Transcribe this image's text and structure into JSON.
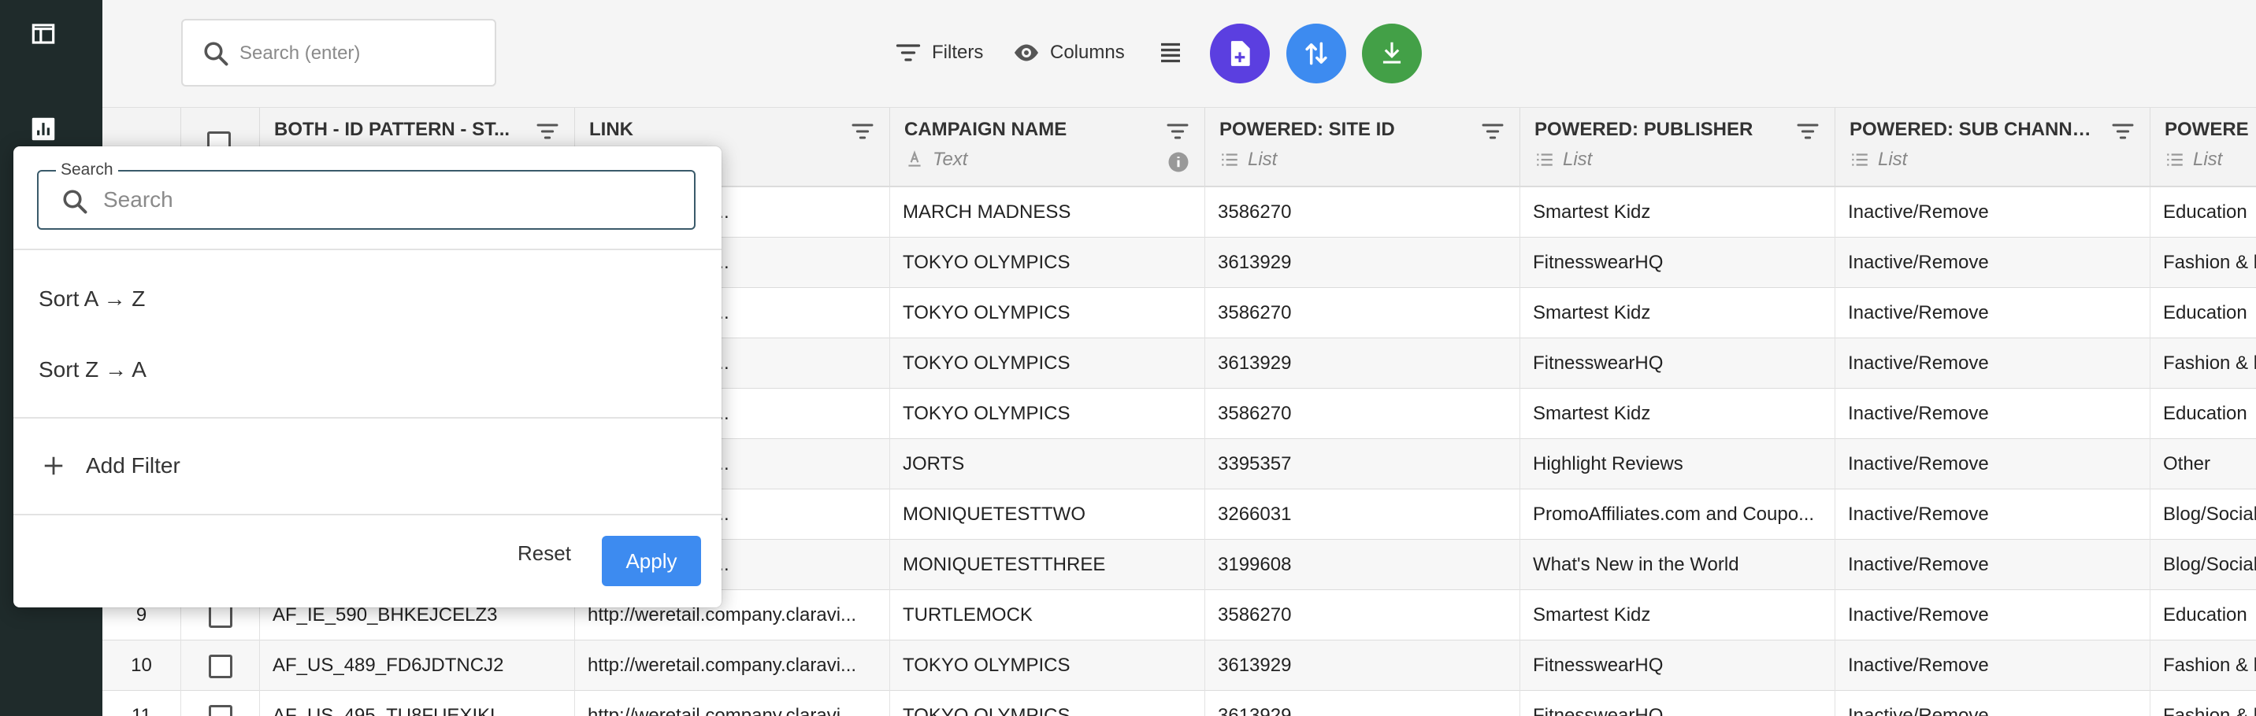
{
  "colors": {
    "rail_bg": "#1f2b2b",
    "btn_purple": "#5b3fe0",
    "btn_blue": "#3d8bf0",
    "btn_green": "#43a047",
    "apply": "#3d8bf0"
  },
  "toolbar": {
    "search_placeholder": "Search (enter)",
    "filters_label": "Filters",
    "columns_label": "Columns"
  },
  "columns": [
    {
      "title": "BOTH - ID PATTERN - ST...",
      "type": ""
    },
    {
      "title": "LINK",
      "type": ""
    },
    {
      "title": "CAMPAIGN NAME",
      "type": "Text"
    },
    {
      "title": "POWERED: SITE ID",
      "type": "List"
    },
    {
      "title": "POWERED: PUBLISHER",
      "type": "List"
    },
    {
      "title": "POWERED: SUB CHANNEL",
      "type": "List"
    },
    {
      "title": "POWERE",
      "type": "List"
    }
  ],
  "rows": [
    {
      "n": "",
      "id": "",
      "link": "ompany.claravi...",
      "campaign": "MARCH MADNESS",
      "site": "3586270",
      "publisher": "Smartest Kidz",
      "sub": "Inactive/Remove",
      "last": "Education"
    },
    {
      "n": "",
      "id": "",
      "link": "ompany.claravi...",
      "campaign": "TOKYO OLYMPICS",
      "site": "3613929",
      "publisher": "FitnesswearHQ",
      "sub": "Inactive/Remove",
      "last": "Fashion & l"
    },
    {
      "n": "",
      "id": "",
      "link": "ompany.claravi...",
      "campaign": "TOKYO OLYMPICS",
      "site": "3586270",
      "publisher": "Smartest Kidz",
      "sub": "Inactive/Remove",
      "last": "Education"
    },
    {
      "n": "",
      "id": "",
      "link": "ompany.claravi...",
      "campaign": "TOKYO OLYMPICS",
      "site": "3613929",
      "publisher": "FitnesswearHQ",
      "sub": "Inactive/Remove",
      "last": "Fashion & l"
    },
    {
      "n": "",
      "id": "",
      "link": "ompany.claravi...",
      "campaign": "TOKYO OLYMPICS",
      "site": "3586270",
      "publisher": "Smartest Kidz",
      "sub": "Inactive/Remove",
      "last": "Education"
    },
    {
      "n": "",
      "id": "",
      "link": "ompany.claravi...",
      "campaign": "JORTS",
      "site": "3395357",
      "publisher": "Highlight Reviews",
      "sub": "Inactive/Remove",
      "last": "Other"
    },
    {
      "n": "",
      "id": "",
      "link": "ompany.claravi...",
      "campaign": "MONIQUETESTTWO",
      "site": "3266031",
      "publisher": "PromoAffiliates.com and Coupo...",
      "sub": "Inactive/Remove",
      "last": "Blog/Social"
    },
    {
      "n": "",
      "id": "",
      "link": "ompany.claravi...",
      "campaign": "MONIQUETESTTHREE",
      "site": "3199608",
      "publisher": "What's New in the World",
      "sub": "Inactive/Remove",
      "last": "Blog/Social"
    },
    {
      "n": "9",
      "id": "AF_IE_590_BHKEJCELZ3",
      "link": "http://weretail.company.claravi...",
      "campaign": "TURTLEMOCK",
      "site": "3586270",
      "publisher": "Smartest Kidz",
      "sub": "Inactive/Remove",
      "last": "Education"
    },
    {
      "n": "10",
      "id": "AF_US_489_FD6JDTNCJ2",
      "link": "http://weretail.company.claravi...",
      "campaign": "TOKYO OLYMPICS",
      "site": "3613929",
      "publisher": "FitnesswearHQ",
      "sub": "Inactive/Remove",
      "last": "Fashion & l"
    },
    {
      "n": "11",
      "id": "AF_US_495_TU8FUEXIKL",
      "link": "http://weretail.company.claravi...",
      "campaign": "TOKYO OLYMPICS",
      "site": "3613929",
      "publisher": "FitnesswearHQ",
      "sub": "Inactive/Remove",
      "last": "Fashion & l"
    }
  ],
  "popup": {
    "search_legend": "Search",
    "search_placeholder": "Search",
    "sort_asc": "Sort A → Z",
    "sort_desc": "Sort Z → A",
    "add_filter": "Add Filter",
    "reset": "Reset",
    "apply": "Apply"
  }
}
